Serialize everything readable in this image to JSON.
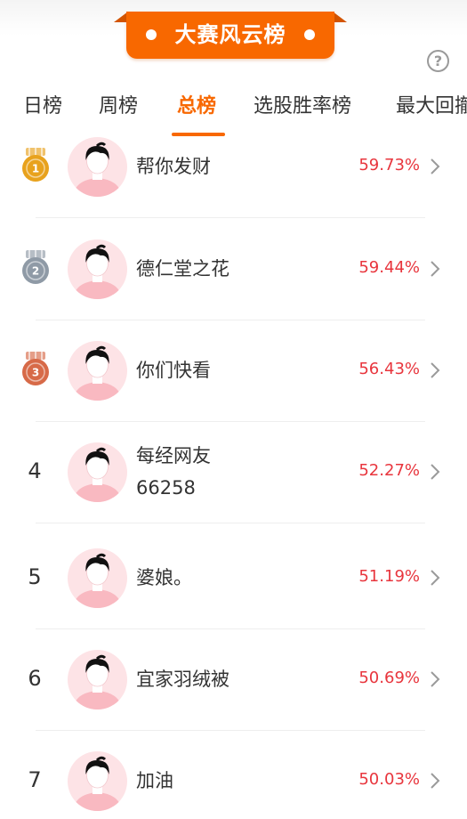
{
  "banner": {
    "title": "大赛风云榜"
  },
  "help": {
    "icon": "question-icon",
    "glyph": "?"
  },
  "tabs": [
    {
      "label": "日榜",
      "active": false
    },
    {
      "label": "周榜",
      "active": false
    },
    {
      "label": "总榜",
      "active": true
    },
    {
      "label": "选股胜率榜",
      "active": false
    },
    {
      "label": "最大回撤",
      "active": false
    }
  ],
  "colors": {
    "accent": "#f86800",
    "rate": "#e8353d",
    "gold": "#e8a21d",
    "silver": "#8f9aa6",
    "bronze": "#d76a48",
    "avatar_bg": "#fde3e6",
    "avatar_shirt": "#f9b9c1"
  },
  "rows": [
    {
      "rank": "1",
      "medal": "gold",
      "name": "帮你发财",
      "name_line2": "",
      "rate": "59.73%"
    },
    {
      "rank": "2",
      "medal": "silver",
      "name": "德仁堂之花",
      "name_line2": "",
      "rate": "59.44%"
    },
    {
      "rank": "3",
      "medal": "bronze",
      "name": "你们快看",
      "name_line2": "",
      "rate": "56.43%"
    },
    {
      "rank": "4",
      "medal": "",
      "name": "每经网友",
      "name_line2": "66258",
      "rate": "52.27%"
    },
    {
      "rank": "5",
      "medal": "",
      "name": "婆娘。",
      "name_line2": "",
      "rate": "51.19%"
    },
    {
      "rank": "6",
      "medal": "",
      "name": "宜家羽绒被",
      "name_line2": "",
      "rate": "50.69%"
    },
    {
      "rank": "7",
      "medal": "",
      "name": "加油",
      "name_line2": "",
      "rate": "50.03%"
    }
  ]
}
